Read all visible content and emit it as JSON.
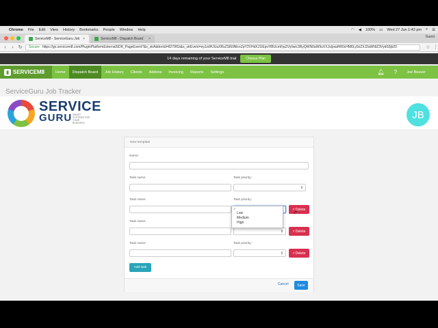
{
  "menubar": {
    "app": "Chrome",
    "items": [
      "File",
      "Edit",
      "View",
      "History",
      "Bookmarks",
      "People",
      "Window",
      "Help"
    ],
    "battery": "100%",
    "clock": "Wed 27 Jun  1:42 pm"
  },
  "browser": {
    "tabs": [
      {
        "title": "ServiceM8 - ServiceGuru Job",
        "active": true
      },
      {
        "title": "ServiceM8 - Dispatch Board",
        "active": false
      }
    ],
    "profile": "Guest",
    "secure_label": "Secure",
    "url": "https://go.servicem8.com/PluginPlatformExternalSDK_PageEvent?&s_strAddonId=8279f1b&s_strEvent=eyJzdHJUaXRsZSI6IlNlcnZpY2VHdXJ1IEpvYiBUcmFja2VyIiwic3RyQWN0aW9uVXJsIjoiaHR0cHM6Ly9zZXJ2aWNlZ3VydS5jb20"
  },
  "trial": {
    "message": "14 days remaining of your ServiceM8 trial",
    "button": "Choose Plan"
  },
  "appnav": {
    "brand": "SERVICEM8",
    "items": [
      "Home",
      "Dispatch Board",
      "Job History",
      "Clients",
      "Addons",
      "Invoicing",
      "Reports",
      "Settings"
    ],
    "active_index": 1,
    "user": "Joe Beaver"
  },
  "page": {
    "tracker_title": "ServiceGuru Job Tracker",
    "logo_line1": "SERVICE",
    "logo_line2": "GURU",
    "logo_tagline": "SMART SYSTEMS FOR YOUR BUSINESS",
    "avatar_initials": "JB"
  },
  "form": {
    "header": "New template",
    "name_label": "Name:",
    "task_name_label": "Task name:",
    "task_priority_label": "Task priority:",
    "delete_label": "× Delete",
    "add_task": "Add task",
    "cancel": "Cancel",
    "save": "Save",
    "priority_options": [
      "",
      "Low",
      "Medium",
      "High"
    ]
  }
}
